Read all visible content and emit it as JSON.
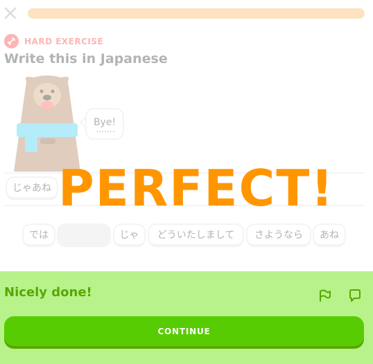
{
  "header": {
    "close_icon": "close-icon",
    "progress": 1.0,
    "progress_color": "#fde3c2"
  },
  "lesson": {
    "badge_icon": "dumbbell-icon",
    "badge_color": "#ff4b4b",
    "badge_label": "HARD EXERCISE",
    "title": "Write this in Japanese",
    "character": "bear",
    "speech": "Bye!",
    "answer_tiles": [
      "じゃあね"
    ],
    "word_bank": [
      "では",
      "",
      "じゃ",
      "どういたしまして",
      "さようなら",
      "あね"
    ]
  },
  "overlay": {
    "text": "PERFECT!",
    "color": "#ff9600"
  },
  "footer": {
    "feedback": "Nicely done!",
    "report_icon": "flag-icon",
    "discuss_icon": "comment-icon",
    "continue_label": "CONTINUE",
    "accent": "#58cc02"
  }
}
